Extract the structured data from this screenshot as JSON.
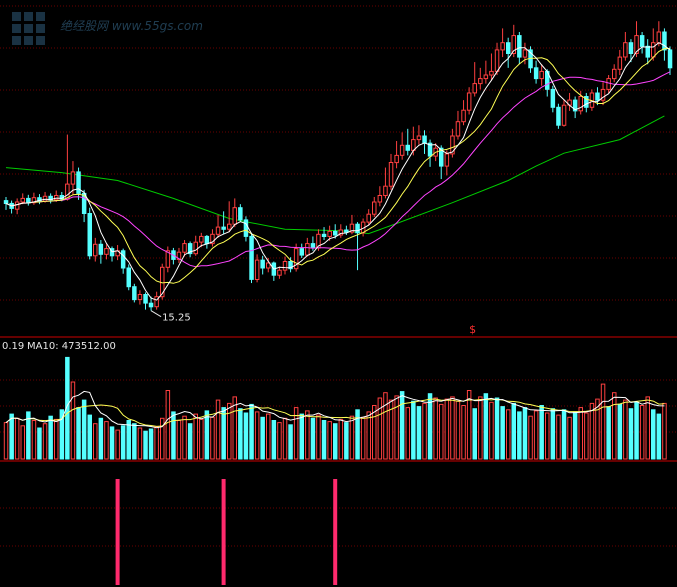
{
  "chart_data": [
    {
      "type": "candlestick",
      "panel": "price",
      "min_label": "15.25",
      "marker": "$",
      "colors": {
        "up": "#ff4040",
        "down": "#55ffff",
        "ma5": "#ffffff",
        "ma10": "#ffff55",
        "ma20": "#ff44ff",
        "ma60": "#00cc00",
        "grid": "#7a0000",
        "border": "#cc0000"
      },
      "candles": [
        {
          "o": 30.6,
          "c": 30.2,
          "h": 31.1,
          "l": 29.3
        },
        {
          "o": 30.2,
          "c": 29.5,
          "h": 30.6,
          "l": 28.8
        },
        {
          "o": 29.4,
          "c": 30.4,
          "h": 30.9,
          "l": 28.7
        },
        {
          "o": 30.4,
          "c": 30.9,
          "h": 31.6,
          "l": 30.1
        },
        {
          "o": 30.9,
          "c": 30.3,
          "h": 31.4,
          "l": 29.9
        },
        {
          "o": 30.3,
          "c": 31.0,
          "h": 31.7,
          "l": 30.0
        },
        {
          "o": 31.0,
          "c": 30.5,
          "h": 31.5,
          "l": 30.1
        },
        {
          "o": 30.5,
          "c": 31.2,
          "h": 31.8,
          "l": 30.3
        },
        {
          "o": 31.2,
          "c": 30.7,
          "h": 31.6,
          "l": 30.2
        },
        {
          "o": 30.7,
          "c": 31.3,
          "h": 32.0,
          "l": 30.4
        },
        {
          "o": 31.3,
          "c": 30.8,
          "h": 31.8,
          "l": 30.5
        },
        {
          "o": 30.8,
          "c": 32.9,
          "h": 39.8,
          "l": 30.6
        },
        {
          "o": 32.9,
          "c": 34.6,
          "h": 36.1,
          "l": 31.4
        },
        {
          "o": 34.6,
          "c": 31.6,
          "h": 35.2,
          "l": 30.7
        },
        {
          "o": 31.6,
          "c": 28.8,
          "h": 32.1,
          "l": 27.6
        },
        {
          "o": 28.8,
          "c": 22.9,
          "h": 29.6,
          "l": 22.4
        },
        {
          "o": 22.9,
          "c": 24.5,
          "h": 25.4,
          "l": 22.1
        },
        {
          "o": 24.5,
          "c": 23.1,
          "h": 25.1,
          "l": 21.8
        },
        {
          "o": 23.1,
          "c": 23.9,
          "h": 24.5,
          "l": 22.4
        },
        {
          "o": 23.9,
          "c": 22.9,
          "h": 24.2,
          "l": 22.1
        },
        {
          "o": 22.9,
          "c": 23.6,
          "h": 24.4,
          "l": 22.3
        },
        {
          "o": 23.6,
          "c": 21.2,
          "h": 23.9,
          "l": 20.4
        },
        {
          "o": 21.2,
          "c": 18.6,
          "h": 21.7,
          "l": 18.1
        },
        {
          "o": 18.6,
          "c": 16.8,
          "h": 19.0,
          "l": 16.4
        },
        {
          "o": 16.8,
          "c": 17.5,
          "h": 18.1,
          "l": 16.1
        },
        {
          "o": 17.5,
          "c": 16.3,
          "h": 17.8,
          "l": 15.4
        },
        {
          "o": 16.3,
          "c": 15.8,
          "h": 17.2,
          "l": 15.25
        },
        {
          "o": 15.8,
          "c": 17.2,
          "h": 17.9,
          "l": 15.4
        },
        {
          "o": 17.2,
          "c": 21.3,
          "h": 21.8,
          "l": 16.8
        },
        {
          "o": 21.3,
          "c": 23.6,
          "h": 24.2,
          "l": 20.6
        },
        {
          "o": 23.6,
          "c": 22.4,
          "h": 24.0,
          "l": 21.7
        },
        {
          "o": 22.4,
          "c": 23.4,
          "h": 24.0,
          "l": 21.9
        },
        {
          "o": 23.4,
          "c": 24.6,
          "h": 25.1,
          "l": 22.8
        },
        {
          "o": 24.6,
          "c": 23.2,
          "h": 24.9,
          "l": 22.7
        },
        {
          "o": 23.2,
          "c": 24.8,
          "h": 25.7,
          "l": 22.9
        },
        {
          "o": 24.8,
          "c": 25.6,
          "h": 26.1,
          "l": 24.1
        },
        {
          "o": 25.6,
          "c": 24.6,
          "h": 25.8,
          "l": 23.9
        },
        {
          "o": 24.6,
          "c": 25.9,
          "h": 26.6,
          "l": 24.2
        },
        {
          "o": 25.9,
          "c": 26.9,
          "h": 28.6,
          "l": 25.4
        },
        {
          "o": 26.9,
          "c": 26.6,
          "h": 29.1,
          "l": 25.9
        },
        {
          "o": 26.6,
          "c": 27.3,
          "h": 30.5,
          "l": 26.2
        },
        {
          "o": 27.3,
          "c": 29.6,
          "h": 30.9,
          "l": 26.9
        },
        {
          "o": 29.6,
          "c": 27.9,
          "h": 30.1,
          "l": 27.6
        },
        {
          "o": 27.9,
          "c": 25.6,
          "h": 28.4,
          "l": 24.9
        },
        {
          "o": 25.6,
          "c": 19.6,
          "h": 26.1,
          "l": 19.1
        },
        {
          "o": 19.6,
          "c": 22.3,
          "h": 23.1,
          "l": 19.2
        },
        {
          "o": 22.3,
          "c": 21.2,
          "h": 22.9,
          "l": 20.3
        },
        {
          "o": 21.2,
          "c": 21.9,
          "h": 22.6,
          "l": 20.6
        },
        {
          "o": 21.9,
          "c": 20.2,
          "h": 22.1,
          "l": 19.4
        },
        {
          "o": 20.2,
          "c": 20.9,
          "h": 21.4,
          "l": 19.7
        },
        {
          "o": 20.9,
          "c": 22.1,
          "h": 22.8,
          "l": 20.3
        },
        {
          "o": 22.1,
          "c": 21.1,
          "h": 22.7,
          "l": 20.6
        },
        {
          "o": 21.1,
          "c": 23.9,
          "h": 24.6,
          "l": 20.7
        },
        {
          "o": 23.9,
          "c": 23.0,
          "h": 24.6,
          "l": 22.6
        },
        {
          "o": 23.0,
          "c": 24.6,
          "h": 25.4,
          "l": 22.8
        },
        {
          "o": 24.6,
          "c": 24.0,
          "h": 25.6,
          "l": 23.6
        },
        {
          "o": 24.0,
          "c": 25.9,
          "h": 26.6,
          "l": 23.6
        },
        {
          "o": 25.9,
          "c": 25.6,
          "h": 26.9,
          "l": 25.1
        },
        {
          "o": 25.6,
          "c": 26.3,
          "h": 27.1,
          "l": 25.0
        },
        {
          "o": 26.3,
          "c": 25.8,
          "h": 27.3,
          "l": 25.3
        },
        {
          "o": 25.8,
          "c": 26.5,
          "h": 27.3,
          "l": 25.4
        },
        {
          "o": 26.5,
          "c": 26.2,
          "h": 27.1,
          "l": 25.8
        },
        {
          "o": 26.2,
          "c": 27.3,
          "h": 28.6,
          "l": 25.9
        },
        {
          "o": 27.3,
          "c": 26.1,
          "h": 27.6,
          "l": 20.9
        },
        {
          "o": 26.1,
          "c": 27.6,
          "h": 28.1,
          "l": 25.6
        },
        {
          "o": 27.6,
          "c": 28.7,
          "h": 29.4,
          "l": 27.1
        },
        {
          "o": 28.7,
          "c": 30.4,
          "h": 31.1,
          "l": 28.3
        },
        {
          "o": 30.4,
          "c": 31.3,
          "h": 32.6,
          "l": 29.8
        },
        {
          "o": 31.3,
          "c": 32.6,
          "h": 35.2,
          "l": 30.9
        },
        {
          "o": 32.6,
          "c": 35.9,
          "h": 37.1,
          "l": 32.1
        },
        {
          "o": 35.9,
          "c": 36.9,
          "h": 38.9,
          "l": 35.1
        },
        {
          "o": 36.9,
          "c": 38.3,
          "h": 40.1,
          "l": 36.3
        },
        {
          "o": 38.3,
          "c": 37.6,
          "h": 40.6,
          "l": 36.9
        },
        {
          "o": 37.6,
          "c": 39.1,
          "h": 40.9,
          "l": 36.9
        },
        {
          "o": 39.1,
          "c": 39.6,
          "h": 41.1,
          "l": 38.4
        },
        {
          "o": 39.6,
          "c": 38.6,
          "h": 40.4,
          "l": 37.1
        },
        {
          "o": 38.6,
          "c": 36.8,
          "h": 39.1,
          "l": 35.3
        },
        {
          "o": 36.8,
          "c": 37.9,
          "h": 38.6,
          "l": 36.1
        },
        {
          "o": 37.9,
          "c": 35.4,
          "h": 38.3,
          "l": 33.6
        },
        {
          "o": 35.4,
          "c": 37.1,
          "h": 37.6,
          "l": 34.1
        },
        {
          "o": 37.1,
          "c": 39.6,
          "h": 40.6,
          "l": 36.6
        },
        {
          "o": 39.6,
          "c": 41.6,
          "h": 43.1,
          "l": 39.1
        },
        {
          "o": 41.6,
          "c": 43.2,
          "h": 44.6,
          "l": 41.1
        },
        {
          "o": 43.2,
          "c": 45.6,
          "h": 46.4,
          "l": 42.6
        },
        {
          "o": 45.6,
          "c": 46.9,
          "h": 49.9,
          "l": 45.1
        },
        {
          "o": 46.9,
          "c": 47.6,
          "h": 49.1,
          "l": 46.1
        },
        {
          "o": 47.6,
          "c": 48.1,
          "h": 50.1,
          "l": 46.9
        },
        {
          "o": 48.1,
          "c": 48.6,
          "h": 51.1,
          "l": 47.3
        },
        {
          "o": 48.6,
          "c": 51.6,
          "h": 52.6,
          "l": 48.1
        },
        {
          "o": 51.6,
          "c": 52.6,
          "h": 54.6,
          "l": 50.6
        },
        {
          "o": 52.6,
          "c": 51.1,
          "h": 53.3,
          "l": 49.1
        },
        {
          "o": 51.1,
          "c": 53.6,
          "h": 55.1,
          "l": 50.6
        },
        {
          "o": 53.6,
          "c": 50.6,
          "h": 54.1,
          "l": 49.6
        },
        {
          "o": 50.6,
          "c": 51.6,
          "h": 52.6,
          "l": 49.6
        },
        {
          "o": 51.6,
          "c": 49.1,
          "h": 52.1,
          "l": 48.4
        },
        {
          "o": 49.1,
          "c": 47.6,
          "h": 50.1,
          "l": 46.9
        },
        {
          "o": 47.6,
          "c": 48.6,
          "h": 49.6,
          "l": 46.6
        },
        {
          "o": 48.6,
          "c": 46.1,
          "h": 48.9,
          "l": 45.1
        },
        {
          "o": 46.1,
          "c": 43.6,
          "h": 46.6,
          "l": 42.9
        },
        {
          "o": 43.6,
          "c": 41.1,
          "h": 44.1,
          "l": 40.6
        },
        {
          "o": 41.1,
          "c": 43.9,
          "h": 44.6,
          "l": 40.9
        },
        {
          "o": 43.9,
          "c": 44.6,
          "h": 45.6,
          "l": 43.1
        },
        {
          "o": 44.6,
          "c": 43.1,
          "h": 45.1,
          "l": 42.1
        },
        {
          "o": 43.1,
          "c": 45.1,
          "h": 45.9,
          "l": 42.6
        },
        {
          "o": 45.1,
          "c": 43.6,
          "h": 45.6,
          "l": 42.9
        },
        {
          "o": 43.6,
          "c": 45.6,
          "h": 46.1,
          "l": 43.1
        },
        {
          "o": 45.6,
          "c": 44.6,
          "h": 46.4,
          "l": 43.9
        },
        {
          "o": 44.6,
          "c": 46.1,
          "h": 47.1,
          "l": 43.9
        },
        {
          "o": 46.1,
          "c": 47.6,
          "h": 48.1,
          "l": 45.6
        },
        {
          "o": 47.6,
          "c": 48.9,
          "h": 49.6,
          "l": 47.1
        },
        {
          "o": 48.9,
          "c": 50.6,
          "h": 51.6,
          "l": 48.1
        },
        {
          "o": 50.6,
          "c": 52.6,
          "h": 54.1,
          "l": 50.1
        },
        {
          "o": 52.6,
          "c": 51.1,
          "h": 53.1,
          "l": 49.9
        },
        {
          "o": 51.1,
          "c": 53.6,
          "h": 55.6,
          "l": 50.6
        },
        {
          "o": 53.6,
          "c": 52.1,
          "h": 54.1,
          "l": 51.1
        },
        {
          "o": 52.1,
          "c": 50.6,
          "h": 53.1,
          "l": 49.6
        },
        {
          "o": 50.6,
          "c": 52.6,
          "h": 54.6,
          "l": 50.1
        },
        {
          "o": 52.6,
          "c": 54.1,
          "h": 55.6,
          "l": 52.1
        },
        {
          "o": 54.1,
          "c": 51.6,
          "h": 54.6,
          "l": 50.1
        },
        {
          "o": 51.6,
          "c": 49.1,
          "h": 52.1,
          "l": 48.1
        }
      ],
      "ma_periods": [
        5,
        10,
        20,
        60
      ],
      "ma60_points": [
        {
          "i": 0,
          "v": 35.2
        },
        {
          "i": 10,
          "v": 34.5
        },
        {
          "i": 20,
          "v": 33.4
        },
        {
          "i": 30,
          "v": 30.9
        },
        {
          "i": 40,
          "v": 28.1
        },
        {
          "i": 50,
          "v": 26.6
        },
        {
          "i": 60,
          "v": 26.4
        },
        {
          "i": 65,
          "v": 26.0
        },
        {
          "i": 70,
          "v": 27.4
        },
        {
          "i": 80,
          "v": 30.3
        },
        {
          "i": 90,
          "v": 33.4
        },
        {
          "i": 95,
          "v": 35.4
        },
        {
          "i": 100,
          "v": 37.2
        },
        {
          "i": 110,
          "v": 39.1
        },
        {
          "i": 118,
          "v": 42.4
        }
      ]
    },
    {
      "type": "bar",
      "panel": "volume",
      "ma_label": "MA10: 473512.00",
      "prefix_label": "0.19",
      "colors": {
        "up": "#ff4040",
        "down": "#55ffff",
        "ma5": "#ffffff",
        "ma10": "#ffff55"
      },
      "values": [
        34,
        42,
        38,
        31,
        44,
        36,
        29,
        33,
        40,
        37,
        46,
        95,
        72,
        48,
        55,
        41,
        33,
        38,
        35,
        30,
        27,
        31,
        36,
        33,
        29,
        26,
        28,
        30,
        38,
        64,
        44,
        36,
        40,
        33,
        42,
        37,
        45,
        39,
        55,
        48,
        52,
        58,
        47,
        43,
        51,
        44,
        39,
        42,
        36,
        34,
        38,
        32,
        48,
        42,
        45,
        38,
        41,
        36,
        35,
        33,
        37,
        34,
        40,
        46,
        39,
        44,
        50,
        57,
        62,
        55,
        59,
        63,
        48,
        54,
        49,
        52,
        61,
        57,
        51,
        56,
        58,
        54,
        50,
        64,
        47,
        58,
        61,
        53,
        57,
        49,
        46,
        52,
        44,
        48,
        40,
        45,
        50,
        43,
        47,
        41,
        46,
        39,
        44,
        48,
        43,
        52,
        56,
        70,
        49,
        62,
        51,
        55,
        47,
        53,
        50,
        58,
        46,
        42,
        52
      ],
      "up": [
        1,
        0,
        1,
        1,
        0,
        1,
        0,
        1,
        0,
        1,
        0,
        0,
        1,
        0,
        0,
        0,
        1,
        0,
        1,
        0,
        1,
        0,
        0,
        0,
        1,
        0,
        0,
        1,
        1,
        1,
        0,
        1,
        1,
        0,
        1,
        1,
        0,
        1,
        1,
        0,
        1,
        1,
        0,
        0,
        0,
        1,
        0,
        1,
        0,
        1,
        1,
        0,
        1,
        0,
        1,
        0,
        1,
        0,
        1,
        0,
        1,
        0,
        1,
        0,
        1,
        1,
        1,
        1,
        1,
        1,
        1,
        0,
        1,
        0,
        0,
        1,
        0,
        1,
        1,
        1,
        1,
        1,
        1,
        1,
        0,
        1,
        0,
        1,
        0,
        0,
        1,
        0,
        0,
        0,
        1,
        1,
        0,
        1,
        0,
        1,
        0,
        1,
        0,
        1,
        1,
        1,
        1,
        1,
        0,
        1,
        0,
        1,
        0,
        0,
        1,
        1,
        0,
        0,
        1
      ]
    },
    {
      "type": "bar",
      "panel": "signal",
      "color": "#ff2a6d",
      "signal_indices": [
        20,
        39,
        59
      ]
    }
  ],
  "watermark": {
    "text": "绝经股网 www.55gs.com"
  }
}
